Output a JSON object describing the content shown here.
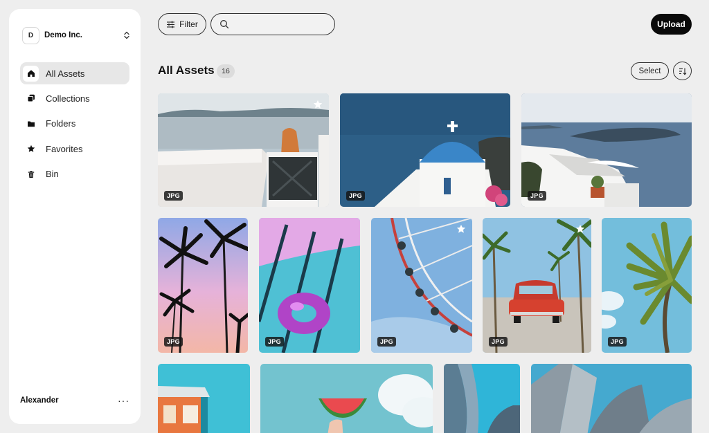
{
  "workspace": {
    "initial": "D",
    "name": "Demo Inc."
  },
  "nav": [
    {
      "label": "All Assets",
      "icon": "home-icon",
      "active": true
    },
    {
      "label": "Collections",
      "icon": "collections-icon"
    },
    {
      "label": "Folders",
      "icon": "folder-icon"
    },
    {
      "label": "Favorites",
      "icon": "star-icon"
    },
    {
      "label": "Bin",
      "icon": "trash-icon"
    }
  ],
  "user": {
    "name": "Alexander",
    "more": "···"
  },
  "toolbar": {
    "filter_label": "Filter",
    "search_placeholder": "",
    "upload_label": "Upload"
  },
  "header": {
    "title": "All Assets",
    "count": "16",
    "select_label": "Select"
  },
  "assets": [
    {
      "name": "santorini-gate",
      "type": "JPG",
      "favorite": true
    },
    {
      "name": "blue-dome-church",
      "type": "JPG",
      "favorite": false
    },
    {
      "name": "white-terrace-sea",
      "type": "JPG",
      "favorite": false
    },
    {
      "name": "palm-silhouettes",
      "type": "JPG",
      "favorite": false
    },
    {
      "name": "pool-float",
      "type": "JPG",
      "favorite": false
    },
    {
      "name": "ferris-wheel",
      "type": "JPG",
      "favorite": true
    },
    {
      "name": "red-vintage-car",
      "type": "JPG",
      "favorite": true
    },
    {
      "name": "palm-tree-sky",
      "type": "JPG",
      "favorite": false
    },
    {
      "name": "lifeguard-hut",
      "type": "",
      "favorite": false
    },
    {
      "name": "watermelon-sky",
      "type": "",
      "favorite": false
    },
    {
      "name": "architecture-curve",
      "type": "",
      "favorite": false
    },
    {
      "name": "metal-building",
      "type": "",
      "favorite": false
    }
  ],
  "colors": {
    "accent": "#0a0a0a",
    "background": "#eeeeee",
    "sidebar": "#ffffff",
    "active_nav": "#e7e7e7"
  }
}
